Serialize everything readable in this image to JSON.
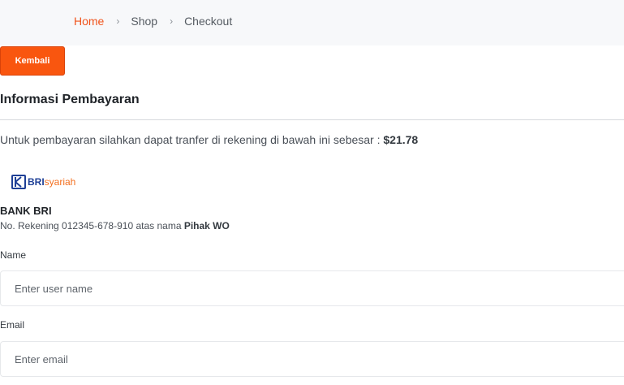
{
  "breadcrumb": {
    "items": [
      "Home",
      "Shop",
      "Checkout"
    ],
    "separator": "›"
  },
  "back_button_label": "Kembali",
  "section_title": "Informasi Pembayaran",
  "payment": {
    "instruction": "Untuk pembayaran silahkan dapat tranfer di rekening di bawah ini sebesar : ",
    "amount": "$21.78"
  },
  "bank": {
    "logo_text_bri": "BRI",
    "logo_text_syariah": "syariah",
    "name": "BANK BRI",
    "account_prefix": "No. Rekening 012345-678-910 atas nama ",
    "account_holder": "Pihak WO"
  },
  "form": {
    "name_label": "Name",
    "name_placeholder": "Enter user name",
    "email_label": "Email",
    "email_placeholder": "Enter email"
  },
  "colors": {
    "accent": "#f9560f",
    "link": "#f0531b",
    "bri_blue": "#1e3f96",
    "bri_orange": "#f37021"
  }
}
